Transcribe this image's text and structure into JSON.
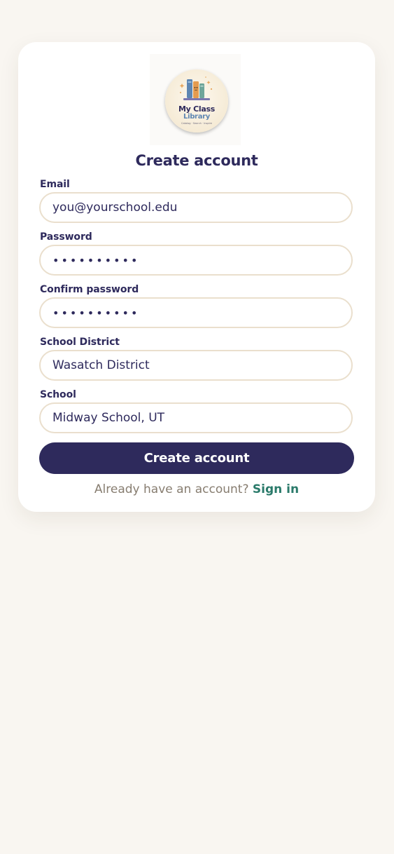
{
  "logo": {
    "line1": "My Class",
    "line2": "Library",
    "tagline": "Catalog · Search · Inspire"
  },
  "form": {
    "title": "Create account",
    "email": {
      "label": "Email",
      "value": "you@yourschool.edu"
    },
    "password": {
      "label": "Password",
      "value": "••••••••••"
    },
    "confirm_password": {
      "label": "Confirm password",
      "value": "••••••••••"
    },
    "district": {
      "label": "School District",
      "value": "Wasatch District"
    },
    "school": {
      "label": "School",
      "value": "Midway School, UT"
    },
    "submit_label": "Create account"
  },
  "footer": {
    "prompt": "Already have an account?",
    "link_label": "Sign in"
  },
  "colors": {
    "background": "#f9f6f1",
    "primary": "#2e2a5c",
    "link": "#2a7a6a",
    "input_border": "#eadfcd",
    "muted_text": "#877d70"
  }
}
